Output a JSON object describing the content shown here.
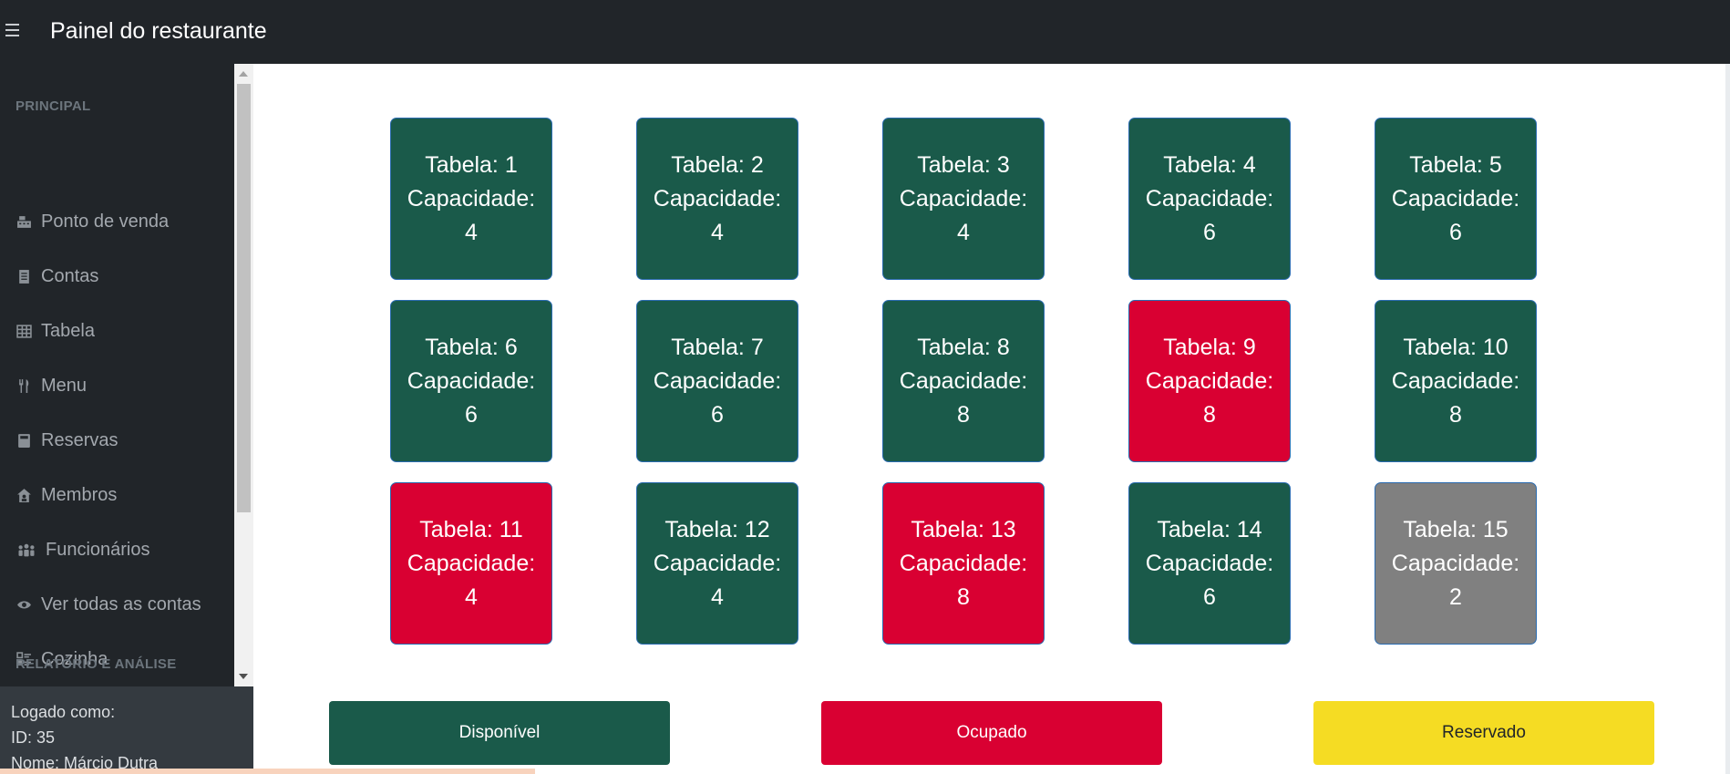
{
  "app": {
    "title": "Painel do restaurante"
  },
  "sidebar": {
    "heading_main": "PRINCIPAL",
    "heading_reports": "RELATÓRIO E ANÁLISE",
    "items": [
      {
        "label": "Ponto de venda",
        "icon": "cash-register-icon"
      },
      {
        "label": "Contas",
        "icon": "receipt-icon"
      },
      {
        "label": "Tabela",
        "icon": "table-grid-icon"
      },
      {
        "label": "Menu",
        "icon": "utensils-icon"
      },
      {
        "label": "Reservas",
        "icon": "book-icon"
      },
      {
        "label": "Membros",
        "icon": "house-user-icon"
      },
      {
        "label": "Funcionários",
        "icon": "people-group-icon"
      },
      {
        "label": "Ver todas as contas",
        "icon": "eye-icon"
      },
      {
        "label": "Cozinha",
        "icon": "kitchen-list-icon"
      }
    ],
    "footer": {
      "logged_as": "Logado como:",
      "id": "ID: 35",
      "name": "Nome: Márcio Dutra"
    }
  },
  "tables": [
    {
      "label": "Tabela: 1",
      "capacity_label": "Capacidade:",
      "capacity": "4",
      "status": "available"
    },
    {
      "label": "Tabela: 2",
      "capacity_label": "Capacidade:",
      "capacity": "4",
      "status": "available"
    },
    {
      "label": "Tabela: 3",
      "capacity_label": "Capacidade:",
      "capacity": "4",
      "status": "available"
    },
    {
      "label": "Tabela: 4",
      "capacity_label": "Capacidade:",
      "capacity": "6",
      "status": "available"
    },
    {
      "label": "Tabela: 5",
      "capacity_label": "Capacidade:",
      "capacity": "6",
      "status": "available"
    },
    {
      "label": "Tabela: 6",
      "capacity_label": "Capacidade:",
      "capacity": "6",
      "status": "available"
    },
    {
      "label": "Tabela: 7",
      "capacity_label": "Capacidade:",
      "capacity": "6",
      "status": "available"
    },
    {
      "label": "Tabela: 8",
      "capacity_label": "Capacidade:",
      "capacity": "8",
      "status": "available"
    },
    {
      "label": "Tabela: 9",
      "capacity_label": "Capacidade:",
      "capacity": "8",
      "status": "occupied"
    },
    {
      "label": "Tabela: 10",
      "capacity_label": "Capacidade:",
      "capacity": "8",
      "status": "available"
    },
    {
      "label": "Tabela: 11",
      "capacity_label": "Capacidade:",
      "capacity": "4",
      "status": "occupied"
    },
    {
      "label": "Tabela: 12",
      "capacity_label": "Capacidade:",
      "capacity": "4",
      "status": "available"
    },
    {
      "label": "Tabela: 13",
      "capacity_label": "Capacidade:",
      "capacity": "8",
      "status": "occupied"
    },
    {
      "label": "Tabela: 14",
      "capacity_label": "Capacidade:",
      "capacity": "6",
      "status": "available"
    },
    {
      "label": "Tabela: 15",
      "capacity_label": "Capacidade:",
      "capacity": "2",
      "status": "gray"
    }
  ],
  "legend": {
    "available": "Disponível",
    "occupied": "Ocupado",
    "reserved": "Reservado"
  },
  "colors": {
    "available": "#1a5a4a",
    "occupied": "#d90032",
    "gray": "#808080",
    "reserved": "#f5dc23",
    "topbar": "#212529",
    "sidebar": "#212529",
    "sidebar_footer": "#343a40"
  }
}
